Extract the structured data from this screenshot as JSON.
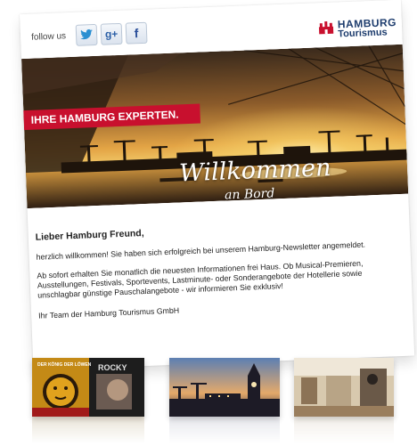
{
  "header": {
    "follow_label": "follow us",
    "social": [
      {
        "icon": "twitter-bird-icon",
        "glyph": "🐦"
      },
      {
        "icon": "google-plus-icon",
        "glyph": "g+"
      },
      {
        "icon": "facebook-icon",
        "glyph": "f"
      }
    ],
    "logo_line1": "HAMBURG",
    "logo_line2": "Tourismus"
  },
  "hero": {
    "banner": "IHRE HAMBURG EXPERTEN.",
    "title": "Willkommen",
    "subtitle": "an Bord"
  },
  "letter": {
    "greeting": "Lieber Hamburg Freund,",
    "p1": "herzlich willkommen! Sie haben sich erfolgreich bei unserem Hamburg-Newsletter angemeldet.",
    "p2_l1": "Ab sofort erhalten Sie monatlich die neuesten Informationen frei Haus. Ob Musical-Premieren,",
    "p2_l2": "Ausstellungen, Festivals, Sportevents, Lastminute- oder Sonderangebote der Hotellerie sowie",
    "p2_l3": "unschlagbar günstige Pauschalangebote - wir informieren Sie exklusiv!",
    "signoff": "Ihr Team der Hamburg Tourismus GmbH"
  },
  "thumbnails": {
    "t1_title": "DER KÖNIG DER LÖWEN",
    "t1_title2": "ROCKY"
  },
  "colors": {
    "brand_red": "#c8102e",
    "brand_blue": "#1e3d6e"
  }
}
